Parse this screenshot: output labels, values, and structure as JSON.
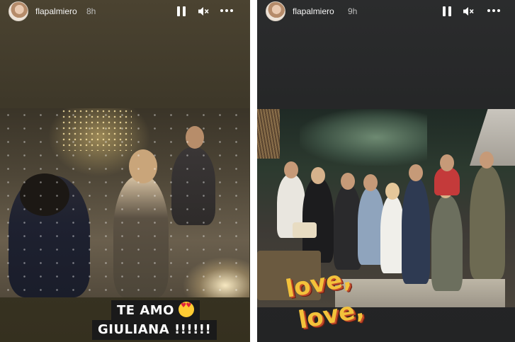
{
  "stories": [
    {
      "username": "flapalmiero",
      "time": "8h",
      "caption_line1": "TE AMO",
      "caption_line2": "GIULIANA !!!!!!"
    },
    {
      "username": "flapalmiero",
      "time": "9h",
      "sticker_line1": "love,",
      "sticker_line2": "love,"
    }
  ]
}
